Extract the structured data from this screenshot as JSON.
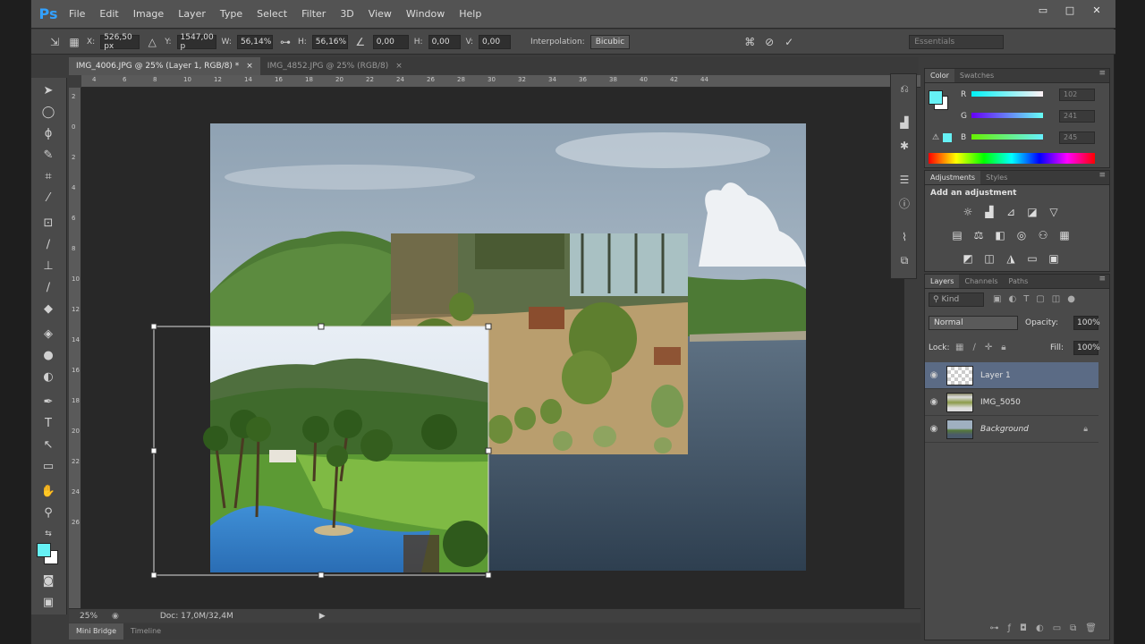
{
  "menu": {
    "logo": "Ps",
    "items": [
      "File",
      "Edit",
      "Image",
      "Layer",
      "Type",
      "Select",
      "Filter",
      "3D",
      "View",
      "Window",
      "Help"
    ]
  },
  "window_buttons": [
    "▭",
    "□",
    "✕"
  ],
  "options": {
    "x_label": "X:",
    "x_value": "526,50 px",
    "y_label": "Y:",
    "y_value": "1547,00 p",
    "w_label": "W:",
    "w_value": "56,14%",
    "h_label": "H:",
    "h_value": "56,16%",
    "angle_value": "0,00",
    "hskew_label": "H:",
    "hskew_value": "0,00",
    "vskew_label": "V:",
    "vskew_value": "0,00",
    "interp_label": "Interpolation:",
    "interp_value": "Bicubic",
    "workspace": "Essentials"
  },
  "tabs": [
    {
      "label": "IMG_4006.JPG @ 25% (Layer 1, RGB/8) *",
      "active": true
    },
    {
      "label": "IMG_4852.JPG @ 25% (RGB/8)",
      "active": false
    }
  ],
  "ruler_top": [
    "4",
    "6",
    "8",
    "10",
    "12",
    "14",
    "16",
    "18",
    "20",
    "22",
    "24",
    "26",
    "28",
    "30",
    "32",
    "34",
    "36",
    "38",
    "40",
    "42",
    "44"
  ],
  "ruler_left": [
    "2",
    "0",
    "2",
    "4",
    "6",
    "8",
    "10",
    "12",
    "14",
    "16",
    "18",
    "20",
    "22",
    "24",
    "26"
  ],
  "status": {
    "zoom": "25%",
    "doc": "Doc: 17,0M/32,4M"
  },
  "bottom_tabs": [
    "Mini Bridge",
    "Timeline"
  ],
  "color_panel": {
    "tabs": [
      "Color",
      "Swatches"
    ],
    "labels": [
      "R",
      "G",
      "B"
    ],
    "values": [
      "102",
      "241",
      "245"
    ],
    "fg": "#66f1f5",
    "bg": "#ffffff"
  },
  "adjustments": {
    "tabs": [
      "Adjustments",
      "Styles"
    ],
    "heading": "Add an adjustment"
  },
  "layers": {
    "tabs": [
      "Layers",
      "Channels",
      "Paths"
    ],
    "kind": "Kind",
    "blend": "Normal",
    "opacity_label": "Opacity:",
    "opacity_value": "100%",
    "lock_label": "Lock:",
    "fill_label": "Fill:",
    "fill_value": "100%",
    "items": [
      {
        "name": "Layer 1",
        "selected": true
      },
      {
        "name": "IMG_5050",
        "selected": false
      },
      {
        "name": "Background",
        "selected": false
      }
    ]
  }
}
